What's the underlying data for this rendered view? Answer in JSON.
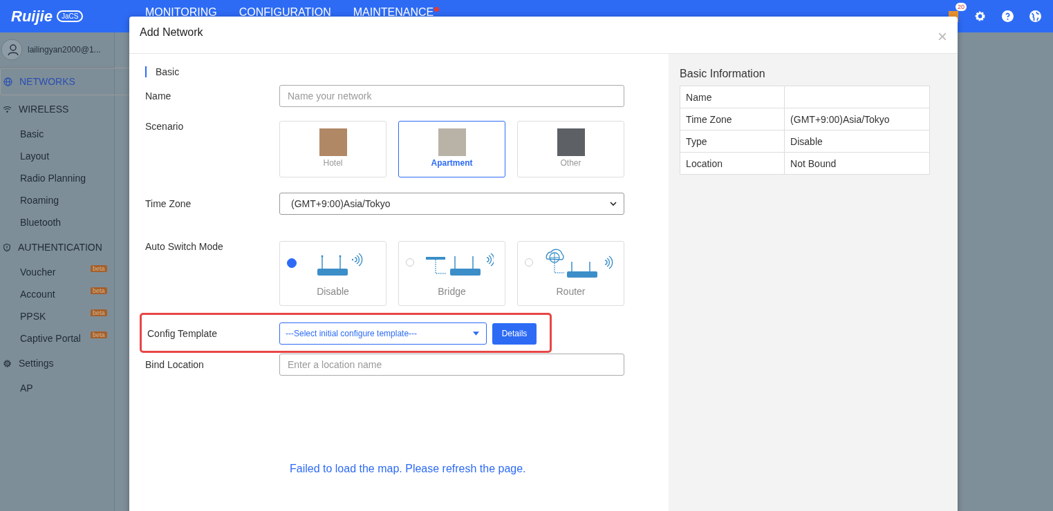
{
  "header": {
    "logo": "Ruijie",
    "logo_badge": "JaCS",
    "nav": [
      {
        "label": "MONITORING",
        "dot": false
      },
      {
        "label": "CONFIGURATION",
        "dot": false
      },
      {
        "label": "MAINTENANCE",
        "dot": true
      }
    ],
    "alert_count": "20"
  },
  "sidebar": {
    "user": "lailingyan2000@1...",
    "items": [
      {
        "label": "NETWORKS",
        "kind": "section",
        "selected": true
      },
      {
        "label": "WIRELESS",
        "kind": "section",
        "selected": false
      },
      {
        "label": "Basic",
        "kind": "item",
        "selected": false
      },
      {
        "label": "Layout",
        "kind": "item",
        "selected": false
      },
      {
        "label": "Radio Planning",
        "kind": "item",
        "selected": false
      },
      {
        "label": "Roaming",
        "kind": "item",
        "selected": false
      },
      {
        "label": "Bluetooth",
        "kind": "item",
        "selected": false
      },
      {
        "label": "AUTHENTICATION",
        "kind": "section",
        "selected": false
      },
      {
        "label": "Voucher",
        "kind": "item",
        "selected": false,
        "beta": "beta"
      },
      {
        "label": "Account",
        "kind": "item",
        "selected": false,
        "beta": "beta"
      },
      {
        "label": "PPSK",
        "kind": "item",
        "selected": false,
        "beta": "beta"
      },
      {
        "label": "Captive Portal",
        "kind": "item",
        "selected": false,
        "beta": "beta"
      },
      {
        "label": "Settings",
        "kind": "section",
        "selected": false
      },
      {
        "label": "AP",
        "kind": "item",
        "selected": false
      }
    ]
  },
  "dialog": {
    "title": "Add Network",
    "close": "×",
    "section": "Basic",
    "name": {
      "label": "Name",
      "placeholder": "Name your network"
    },
    "scenario": {
      "label": "Scenario",
      "options": [
        {
          "label": "Hotel",
          "selected": false
        },
        {
          "label": "Apartment",
          "selected": true
        },
        {
          "label": "Other",
          "selected": false
        }
      ]
    },
    "time_zone": {
      "label": "Time Zone",
      "value": "(GMT+9:00)Asia/Tokyo"
    },
    "auto_switch_mode": {
      "label": "Auto Switch Mode",
      "options": [
        {
          "label": "Disable",
          "kind": "router",
          "selected": true
        },
        {
          "label": "Bridge",
          "kind": "bridge",
          "selected": false
        },
        {
          "label": "Router",
          "kind": "cloud",
          "selected": false
        }
      ]
    },
    "config_template": {
      "label": "Config Template",
      "value": "---Select initial configure template---",
      "button": "Details",
      "highlighted": true
    },
    "bind_location": {
      "label": "Bind Location",
      "placeholder": "Enter a location name"
    },
    "map_error": "Failed to load the map. Please refresh the page.",
    "info": {
      "title": "Basic Information",
      "rows": [
        {
          "key": "Name",
          "value": ""
        },
        {
          "key": "Time Zone",
          "value": "(GMT+9:00)Asia/Tokyo"
        },
        {
          "key": "Type",
          "value": "Disable"
        },
        {
          "key": "Location",
          "value": "Not Bound"
        }
      ]
    }
  }
}
